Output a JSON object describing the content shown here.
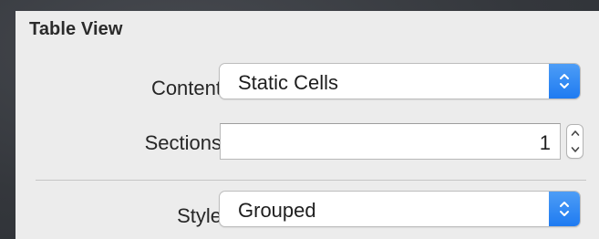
{
  "section": {
    "title": "Table View"
  },
  "content": {
    "label": "Content",
    "value": "Static Cells",
    "control_icon": "up-down-chevrons-icon"
  },
  "sections": {
    "label": "Sections",
    "value": "1",
    "stepper_icon": "stepper-icon"
  },
  "style": {
    "label": "Style",
    "value": "Grouped",
    "control_icon": "up-down-chevrons-icon"
  },
  "colors": {
    "panel_background": "#ececec",
    "accent": "#2a84f4",
    "backdrop": "#3a3d42"
  }
}
